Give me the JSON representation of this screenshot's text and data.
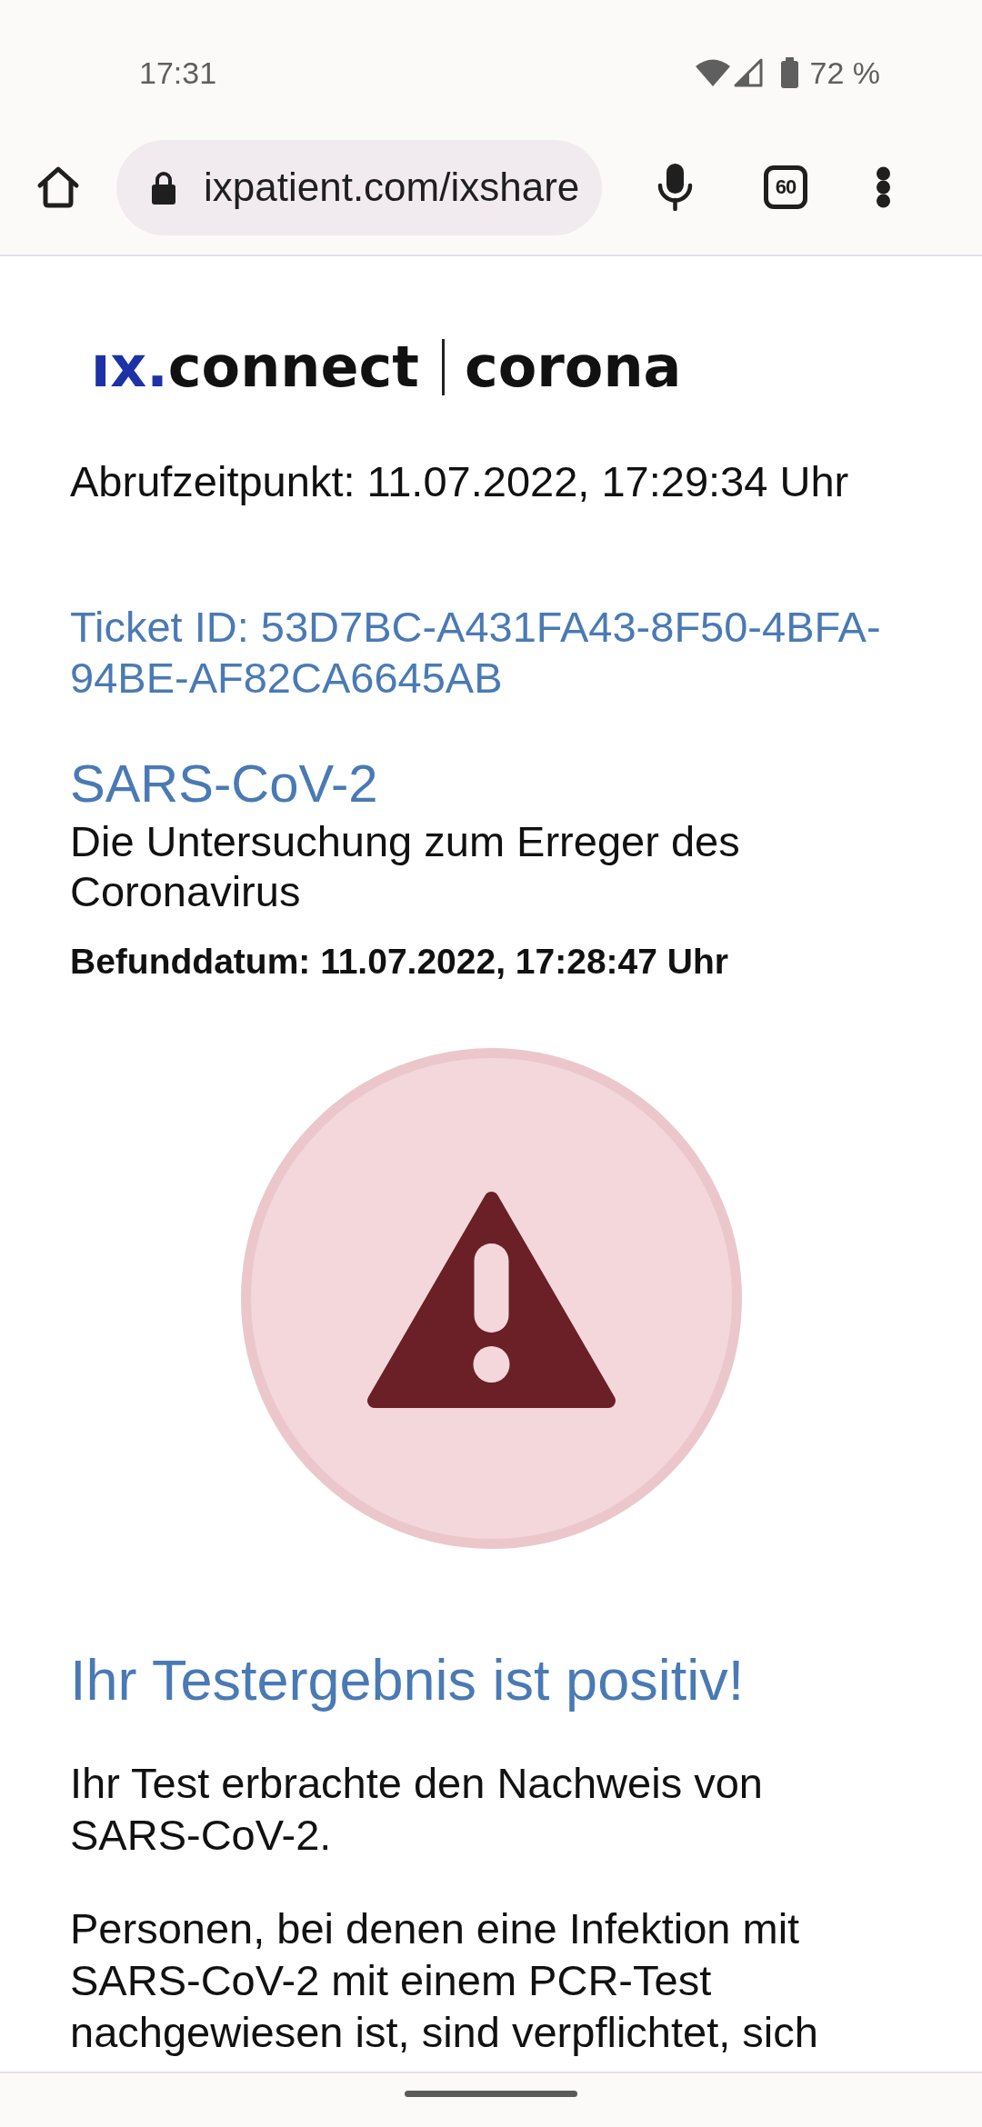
{
  "status_bar": {
    "time": "17:31",
    "battery": "72 %"
  },
  "browser_toolbar": {
    "url": "ixpatient.com/ixshare",
    "tab_count": "60"
  },
  "page": {
    "logo": {
      "prefix": "ıx.",
      "name": "connect",
      "product": "corona"
    },
    "retrieved_at": "Abrufzeitpunkt: 11.07.2022, 17:29:34 Uhr",
    "ticket_id": "Ticket ID: 53D7BC-A431FA43-8F50-4BFA-94BE-AF82CA6645AB",
    "test": {
      "title": "SARS-CoV-2",
      "subtitle": "Die Untersuchung zum Erreger des Coronavirus",
      "result_date": "Befunddatum: 11.07.2022, 17:28:47 Uhr"
    },
    "result": {
      "kind": "warning",
      "heading": "Ihr Testergebnis ist positiv!",
      "paragraphs": [
        "Ihr Test erbrachte den Nachweis von SARS-CoV-2.",
        "Personen, bei denen eine Infektion mit SARS-CoV-2 mit einem PCR-Test nachgewiesen ist, sind verpflichtet, sich"
      ]
    }
  }
}
